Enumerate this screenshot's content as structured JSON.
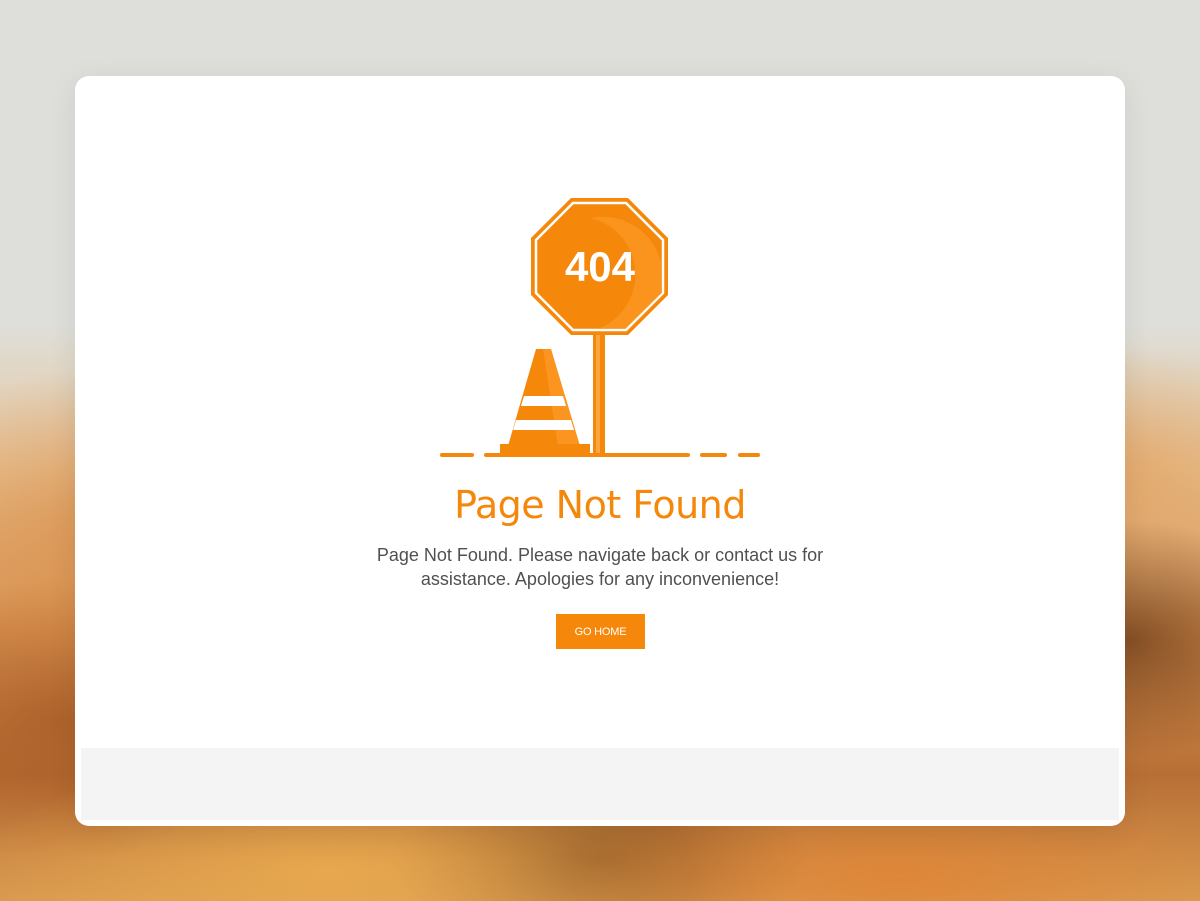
{
  "colors": {
    "accent": "#f5870a",
    "accent_light": "#ff9f2e",
    "text_muted": "#505050",
    "card_bg": "#ffffff",
    "footer_bg": "#f4f4f4"
  },
  "illustration": {
    "sign_text": "404",
    "sign_icon": "stop-sign-icon",
    "cone_icon": "traffic-cone-icon"
  },
  "main": {
    "title": "Page Not Found",
    "message": "Page Not Found. Please navigate back or contact us for assistance. Apologies for any inconvenience!",
    "button_label": "GO HOME"
  }
}
